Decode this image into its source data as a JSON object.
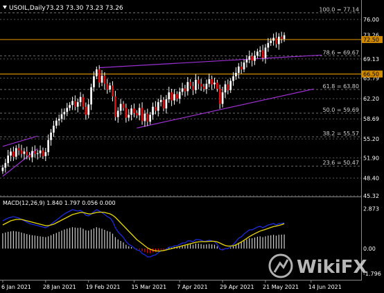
{
  "header": {
    "symbol": "USOIL,Daily",
    "ohlc": "73.23 73.30 73.23 73.26",
    "triangle_icon": "triangle-down-icon"
  },
  "colors": {
    "background": "#000000",
    "grid": "#5a5a5a",
    "text": "#ffffff",
    "bull_candle": "#ffffff",
    "bear_candle": "#e01010",
    "wick": "#ffffff",
    "channel": "#9b30d0",
    "level_line": "#d08a00",
    "price_label_bg": "#d08a00",
    "fib_text": "#cfcfcf",
    "macd_main": "#1a2bdc",
    "macd_signal": "#e8d800",
    "macd_hist": "#d0d0d0",
    "macd_hist_neg": "#e01010"
  },
  "chart_data": [
    {
      "type": "candlestick",
      "title": "USOIL,Daily",
      "ylim": [
        45.3,
        78.9
      ],
      "price_ticks": [
        "76.00",
        "69.13",
        "65.79",
        "62.20",
        "58.69",
        "55.20",
        "51.90",
        "48.40",
        "45.32"
      ],
      "price_tick_values": [
        76.0,
        69.13,
        65.79,
        62.2,
        58.69,
        55.2,
        51.9,
        48.4,
        45.32
      ],
      "price_labels": [
        {
          "text": "73.26",
          "value": 73.26,
          "style": "plain"
        },
        {
          "text": "72.50",
          "value": 72.5,
          "style": "box"
        },
        {
          "text": "66.50",
          "value": 66.5,
          "style": "box"
        }
      ],
      "x_labels": [
        "6 Jan 2021",
        "28 Jan 2021",
        "19 Feb 2021",
        "15 Mar 2021",
        "7 Apr 2021",
        "29 Apr 2021",
        "21 May 2021",
        "14 Jun 2021"
      ],
      "x_label_index": [
        0,
        16,
        32,
        49,
        66,
        82,
        98,
        115
      ],
      "fib_levels": [
        {
          "text": "100.0 = 77.14",
          "value": 77.14
        },
        {
          "text": "78.6 = 69.67",
          "value": 69.67
        },
        {
          "text": "61.8 = 63.80",
          "value": 63.8
        },
        {
          "text": "50.0 = 59.69",
          "value": 59.69
        },
        {
          "text": "38.2 = 55.57",
          "value": 55.57
        },
        {
          "text": "23.6 = 50.47",
          "value": 50.47
        }
      ],
      "horizontal_levels": [
        72.5,
        66.5
      ],
      "channels": [
        {
          "from": [
            0,
            48.7
          ],
          "to": [
            13,
            53.5
          ]
        },
        {
          "from": [
            0,
            53.9
          ],
          "to": [
            13,
            55.7
          ]
        },
        {
          "from": [
            36,
            67.6
          ],
          "to": [
            119,
            69.8
          ]
        },
        {
          "from": [
            50,
            57.1
          ],
          "to": [
            116,
            63.9
          ]
        }
      ],
      "close": [
        50.2,
        51.0,
        52.3,
        53.0,
        52.1,
        53.6,
        53.2,
        52.6,
        53.0,
        52.4,
        52.0,
        53.1,
        52.6,
        52.7,
        53.2,
        52.2,
        52.9,
        55.0,
        56.3,
        57.5,
        58.4,
        58.7,
        59.5,
        59.9,
        60.6,
        61.1,
        61.8,
        60.8,
        61.6,
        62.5,
        60.8,
        59.4,
        61.2,
        64.2,
        66.1,
        67.3,
        65.0,
        66.2,
        64.8,
        63.8,
        64.5,
        62.6,
        59.0,
        60.1,
        61.3,
        60.6,
        58.9,
        59.4,
        60.5,
        59.7,
        59.3,
        60.6,
        58.3,
        59.6,
        58.2,
        59.4,
        60.8,
        60.1,
        61.6,
        62.0,
        60.5,
        62.1,
        63.3,
        61.9,
        63.0,
        62.2,
        63.4,
        64.0,
        63.5,
        65.1,
        64.4,
        63.7,
        65.5,
        64.8,
        64.3,
        63.9,
        64.8,
        65.6,
        64.7,
        65.0,
        63.9,
        61.3,
        63.3,
        64.7,
        63.7,
        65.3,
        66.1,
        66.7,
        67.8,
        67.3,
        68.5,
        69.0,
        69.6,
        68.8,
        69.7,
        70.4,
        70.6,
        69.3,
        71.1,
        71.9,
        72.3,
        72.8,
        71.7,
        73.0,
        72.6,
        73.26
      ],
      "macd": {
        "label": "MACD(12,26,9) 1.840 1.797 0.056 0.000",
        "ylim": [
          -2.2,
          3.6
        ],
        "ticks": [
          "2.873",
          "0.00",
          "-1.796"
        ],
        "tick_values": [
          2.873,
          0.0,
          -1.796
        ],
        "main": [
          2.0,
          2.1,
          2.2,
          2.25,
          2.3,
          2.25,
          2.2,
          2.1,
          2.0,
          1.9,
          1.8,
          1.75,
          1.7,
          1.65,
          1.6,
          1.55,
          1.5,
          1.6,
          1.75,
          1.9,
          2.05,
          2.2,
          2.35,
          2.5,
          2.6,
          2.7,
          2.8,
          2.75,
          2.7,
          2.75,
          2.6,
          2.4,
          2.35,
          2.5,
          2.65,
          2.8,
          2.7,
          2.6,
          2.45,
          2.3,
          2.2,
          1.95,
          1.5,
          1.2,
          1.0,
          0.8,
          0.5,
          0.3,
          0.2,
          0.05,
          -0.1,
          -0.15,
          -0.35,
          -0.45,
          -0.6,
          -0.6,
          -0.5,
          -0.45,
          -0.3,
          -0.15,
          -0.15,
          -0.05,
          0.1,
          0.1,
          0.2,
          0.2,
          0.3,
          0.4,
          0.4,
          0.55,
          0.55,
          0.5,
          0.65,
          0.65,
          0.6,
          0.5,
          0.55,
          0.6,
          0.55,
          0.5,
          0.3,
          -0.05,
          -0.1,
          0.0,
          0.0,
          0.15,
          0.3,
          0.5,
          0.75,
          0.85,
          1.05,
          1.2,
          1.35,
          1.35,
          1.45,
          1.55,
          1.6,
          1.5,
          1.6,
          1.7,
          1.75,
          1.8,
          1.7,
          1.8,
          1.82,
          1.84
        ],
        "signal": [
          1.7,
          1.8,
          1.9,
          2.0,
          2.05,
          2.1,
          2.1,
          2.1,
          2.05,
          2.0,
          1.95,
          1.9,
          1.85,
          1.8,
          1.75,
          1.7,
          1.65,
          1.65,
          1.7,
          1.75,
          1.85,
          1.95,
          2.05,
          2.15,
          2.25,
          2.35,
          2.45,
          2.5,
          2.55,
          2.6,
          2.6,
          2.55,
          2.5,
          2.5,
          2.55,
          2.6,
          2.62,
          2.62,
          2.6,
          2.55,
          2.5,
          2.4,
          2.25,
          2.05,
          1.85,
          1.65,
          1.45,
          1.25,
          1.05,
          0.85,
          0.65,
          0.5,
          0.35,
          0.2,
          0.05,
          -0.05,
          -0.12,
          -0.16,
          -0.18,
          -0.17,
          -0.14,
          -0.1,
          -0.05,
          0.0,
          0.05,
          0.1,
          0.15,
          0.2,
          0.25,
          0.3,
          0.35,
          0.4,
          0.45,
          0.48,
          0.5,
          0.5,
          0.5,
          0.52,
          0.53,
          0.52,
          0.48,
          0.4,
          0.3,
          0.22,
          0.18,
          0.18,
          0.2,
          0.27,
          0.37,
          0.48,
          0.6,
          0.73,
          0.86,
          0.97,
          1.07,
          1.17,
          1.26,
          1.32,
          1.38,
          1.45,
          1.52,
          1.58,
          1.62,
          1.67,
          1.72,
          1.797
        ],
        "hist_style": "bars"
      }
    }
  ],
  "watermark": {
    "text": "WikiFX",
    "logo_icon": "wikifx-logo-icon"
  }
}
